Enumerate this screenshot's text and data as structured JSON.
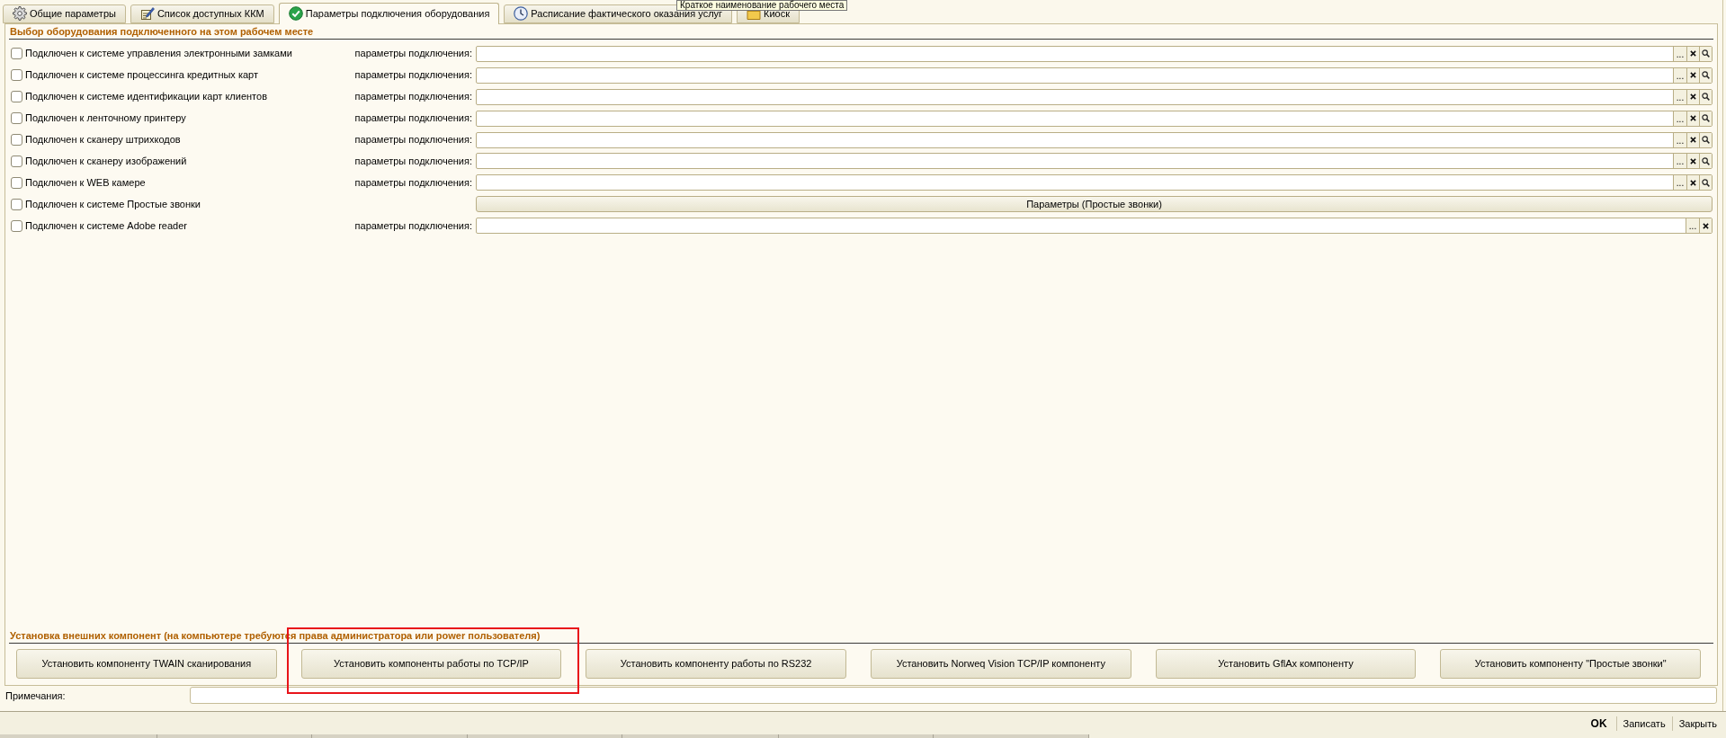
{
  "tooltip": {
    "text": "Краткое наименование рабочего места"
  },
  "tabs": [
    {
      "label": "Общие параметры",
      "selected": false
    },
    {
      "label": "Список доступных ККМ",
      "selected": false
    },
    {
      "label": "Параметры подключения оборудования",
      "selected": true
    },
    {
      "label": "Расписание фактического оказания услуг",
      "selected": false
    },
    {
      "label": "Киоск",
      "selected": false
    }
  ],
  "equipment": {
    "title": "Выбор оборудования подключенного на этом рабочем месте",
    "rows": [
      {
        "kind": "field",
        "label": "Подключен к системе управления электронными замками",
        "checked": false,
        "field_label": "параметры подключения:",
        "select_button": "...",
        "search": true
      },
      {
        "kind": "field",
        "label": "Подключен к системе процессинга кредитных карт",
        "checked": false,
        "field_label": "параметры подключения:",
        "select_button": "...",
        "search": true
      },
      {
        "kind": "field",
        "label": "Подключен к системе идентификации карт клиентов",
        "checked": false,
        "field_label": "параметры подключения:",
        "select_button": "...",
        "search": true
      },
      {
        "kind": "field",
        "label": "Подключен к ленточному принтеру",
        "checked": false,
        "field_label": "параметры подключения:",
        "select_button": "...",
        "search": true
      },
      {
        "kind": "field",
        "label": "Подключен к сканеру штрихкодов",
        "checked": false,
        "field_label": "параметры подключения:",
        "select_button": "...",
        "search": true
      },
      {
        "kind": "field",
        "label": "Подключен к сканеру изображений",
        "checked": false,
        "field_label": "параметры подключения:",
        "select_button": "...",
        "search": true
      },
      {
        "kind": "field",
        "label": "Подключен к WEB камере",
        "checked": false,
        "field_label": "параметры подключения:",
        "select_button": "...",
        "search": true
      },
      {
        "kind": "button",
        "label": "Подключен к системе Простые звонки",
        "checked": false,
        "button": "Параметры (Простые звонки)"
      },
      {
        "kind": "field",
        "label": "Подключен к системе Adobe reader",
        "checked": false,
        "field_label": "параметры подключения:",
        "select_button": "...",
        "search": false
      }
    ]
  },
  "components": {
    "title": "Установка внешних компонент (на компьютере требуются права администратора или power пользователя)",
    "buttons": [
      {
        "label": "Установить компоненту TWAIN сканирования",
        "highlighted": false
      },
      {
        "label": "Установить компоненты работы по TCP/IP",
        "highlighted": true
      },
      {
        "label": "Установить компоненту работы по RS232",
        "highlighted": false
      },
      {
        "label": "Установить Norweq Vision TCP/IP компоненту",
        "highlighted": false
      },
      {
        "label": "Установить GflAx компоненту",
        "highlighted": false
      },
      {
        "label": "Установить компоненту \"Простые звонки\"",
        "highlighted": false
      }
    ]
  },
  "notes": {
    "label": "Примечания:"
  },
  "footer": {
    "buttons": [
      {
        "label": "OK",
        "default": true
      },
      {
        "label": "Записать",
        "default": false
      },
      {
        "label": "Закрыть",
        "default": false
      }
    ]
  }
}
